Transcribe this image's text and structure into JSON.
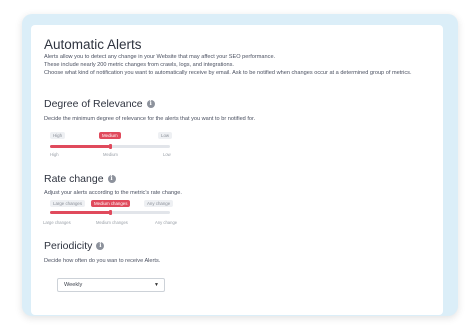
{
  "header": {
    "title": "Automatic Alerts",
    "desc_lines": [
      "Alerts allow you to detect any change in your Website that may affect your SEO performance.",
      "These include nearly 200 metric changes from crawls, logs, and integrations.",
      "Choose what kind of notification you want to automatically receive by email. Ask to be notified when changes occur at a determined group of metrics."
    ]
  },
  "relevance": {
    "title": "Degree of Relevance",
    "info_icon": "i",
    "description": "Decide the minimum degree of relevance for the alerts that you want to br notified for.",
    "pills": [
      "High",
      "Medium",
      "Low"
    ],
    "active_index": 1,
    "ticks": [
      "High",
      "Medium",
      "Low"
    ],
    "level": 0.5
  },
  "rate": {
    "title": "Rate change",
    "info_icon": "i",
    "description": "Adjust your alerts according to the metric's rate change.",
    "pills": [
      "Large changes",
      "Medium changes",
      "Any change"
    ],
    "active_index": 1,
    "ticks": [
      "Large changes",
      "Medium changes",
      "Any change"
    ],
    "level": 0.5
  },
  "periodicity": {
    "title": "Periodicity",
    "info_icon": "i",
    "description": "Decide how often do you wan to receive Alerts.",
    "selected": "Weekly",
    "caret": "▼"
  },
  "colors": {
    "accent": "#e04a5c",
    "frame": "#dbeef8"
  }
}
